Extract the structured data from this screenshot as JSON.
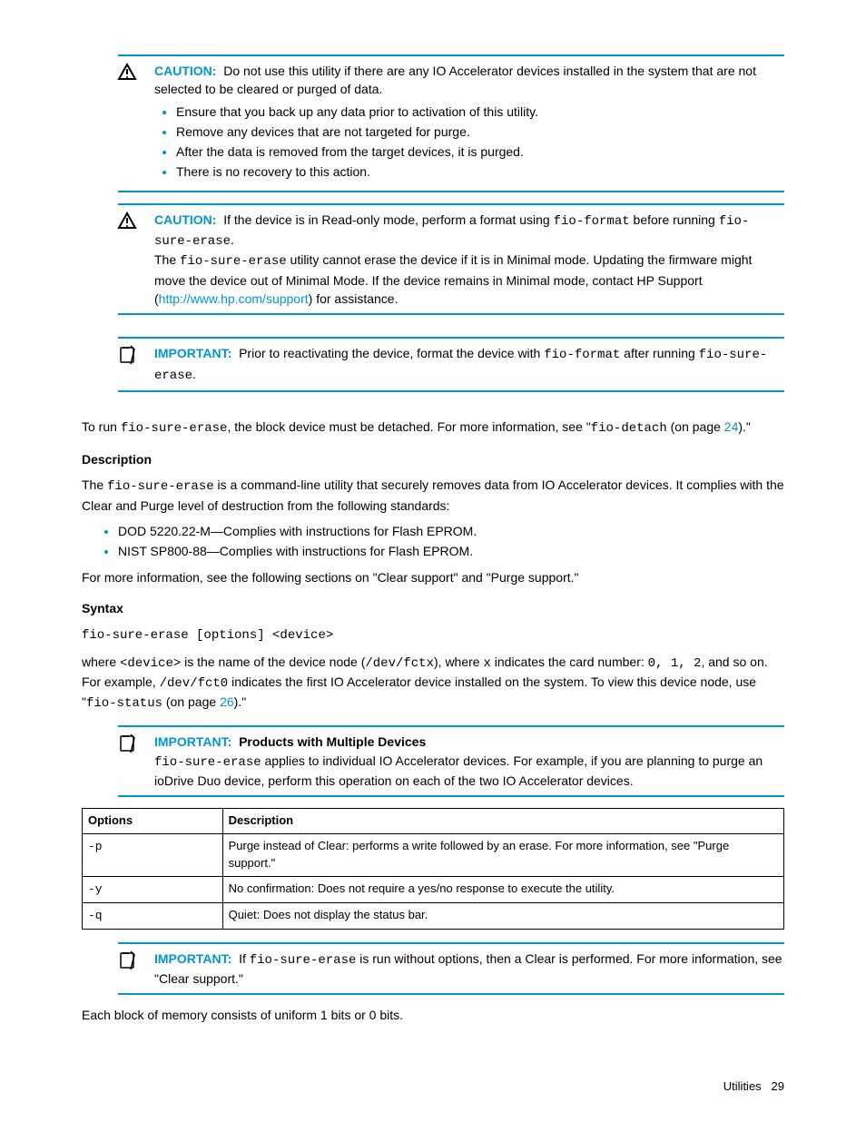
{
  "caution1": {
    "label": "CAUTION:",
    "lead": "Do not use this utility if there are any IO Accelerator devices installed in the system that are not selected to be cleared or purged of data.",
    "bullets": [
      "Ensure that you back up any data prior to activation of this utility.",
      "Remove any devices that are not targeted for purge.",
      "After the data is removed from the target devices, it is purged.",
      "There is no recovery to this action."
    ]
  },
  "caution2": {
    "label": "CAUTION:",
    "t1a": "If the device is in Read-only mode, perform a format using ",
    "code1": "fio-format",
    "t1b": " before running ",
    "code2": "fio-sure-erase",
    "t1c": ".",
    "t2a": "The ",
    "code3": "fio-sure-erase",
    "t2b": " utility cannot erase the device if it is in Minimal mode. Updating the firmware might move the device out of Minimal Mode. If the device remains in Minimal mode, contact HP Support (",
    "link": "http://www.hp.com/support",
    "t2c": ") for assistance."
  },
  "important1": {
    "label": "IMPORTANT:",
    "t1a": "Prior to reactivating the device, format the device with ",
    "code1": "fio-format",
    "t1b": " after running ",
    "code2": "fio-sure-erase",
    "t1c": "."
  },
  "run": {
    "a": "To run ",
    "code": "fio-sure-erase",
    "b": ", the block device must be detached. For more information, see \"",
    "code2": "fio-detach",
    "c": " (on page ",
    "page": "24",
    "d": ").\""
  },
  "descHead": "Description",
  "desc": {
    "a": "The ",
    "code": "fio-sure-erase",
    "b": " is a command-line utility that securely removes data from IO Accelerator devices. It complies with the Clear and Purge level of destruction from the following standards:"
  },
  "standards": [
    "DOD 5220.22-M—Complies with instructions for Flash EPROM.",
    "NIST SP800-88—Complies with instructions for Flash EPROM."
  ],
  "moreInfo": "For more information, see the following sections on \"Clear support\" and \"Purge support.\"",
  "syntaxHead": "Syntax",
  "syntaxCmd": "fio-sure-erase [options] <device>",
  "where": {
    "a": "where ",
    "c1": "<device>",
    "b": " is the name of the device node (",
    "c2": "/dev/fctx",
    "c": "), where ",
    "c3": "x",
    "d": " indicates the card number: ",
    "c4": "0, 1, 2",
    "e": ", and so on. For example, ",
    "c5": "/dev/fct0",
    "f": " indicates the first IO Accelerator device installed on the system. To view this device node, use \"",
    "c6": "fio-status",
    "g": " (on page ",
    "page": "26",
    "h": ").\""
  },
  "important2": {
    "label": "IMPORTANT:",
    "title": "Products with Multiple Devices",
    "a": "",
    "code": "fio-sure-erase",
    "b": " applies to individual IO Accelerator devices. For example, if you are planning to purge an ioDrive Duo device, perform this operation on each of the two IO Accelerator devices."
  },
  "table": {
    "h1": "Options",
    "h2": "Description",
    "rows": [
      {
        "opt": "-p",
        "desc": "Purge instead of Clear: performs a write followed by an erase. For more information, see \"Purge support.\""
      },
      {
        "opt": "-y",
        "desc": "No confirmation: Does not require a yes/no response to execute the utility."
      },
      {
        "opt": "-q",
        "desc": "Quiet: Does not display the status bar."
      }
    ]
  },
  "important3": {
    "label": "IMPORTANT:",
    "a": "If ",
    "code": "fio-sure-erase",
    "b": " is run without options, then a Clear is performed. For more information, see \"Clear support.\""
  },
  "closing": "Each block of memory consists of uniform 1 bits or 0 bits.",
  "footer": {
    "section": "Utilities",
    "page": "29"
  }
}
